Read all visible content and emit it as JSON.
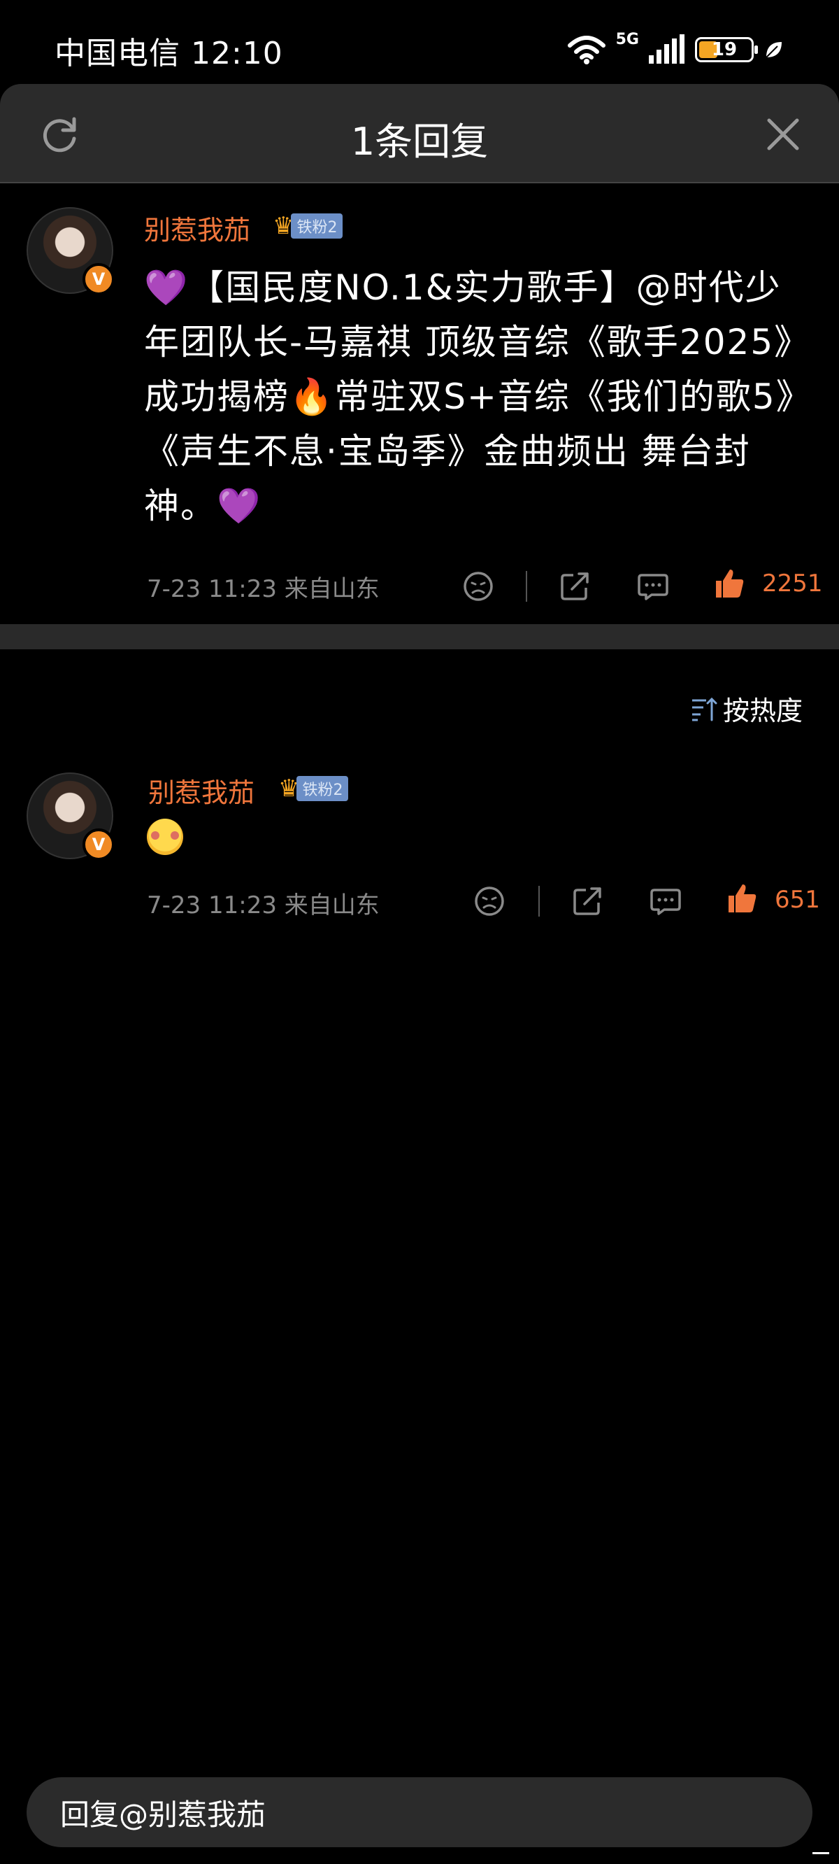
{
  "status_bar": {
    "carrier_time": "中国电信 12:10",
    "network": "5G",
    "battery": "19",
    "battery_level": 0.19
  },
  "header": {
    "title": "1条回复"
  },
  "main_comment": {
    "username": "别惹我茄",
    "fan_badge": "铁粉2",
    "text": "💜【国民度NO.1&实力歌手】@时代少年团队长-马嘉祺 顶级音综《歌手2025》成功揭榜🔥常驻双S+音综《我们的歌5》《声生不息·宝岛季》金曲频出 舞台封神。💜",
    "meta": "7-23 11:23 来自山东",
    "likes": "2251"
  },
  "sort": {
    "label": "按热度"
  },
  "reply": {
    "username": "别惹我茄",
    "fan_badge": "铁粉2",
    "meta": "7-23 11:23 来自山东",
    "likes": "651"
  },
  "reply_input": {
    "placeholder": "回复@别惹我茄"
  },
  "colors": {
    "background": "#000000",
    "header": "#2b2b2b",
    "accent": "#f0763c",
    "meta_text": "#8a8a8a",
    "badge": "#6c8fc7"
  }
}
